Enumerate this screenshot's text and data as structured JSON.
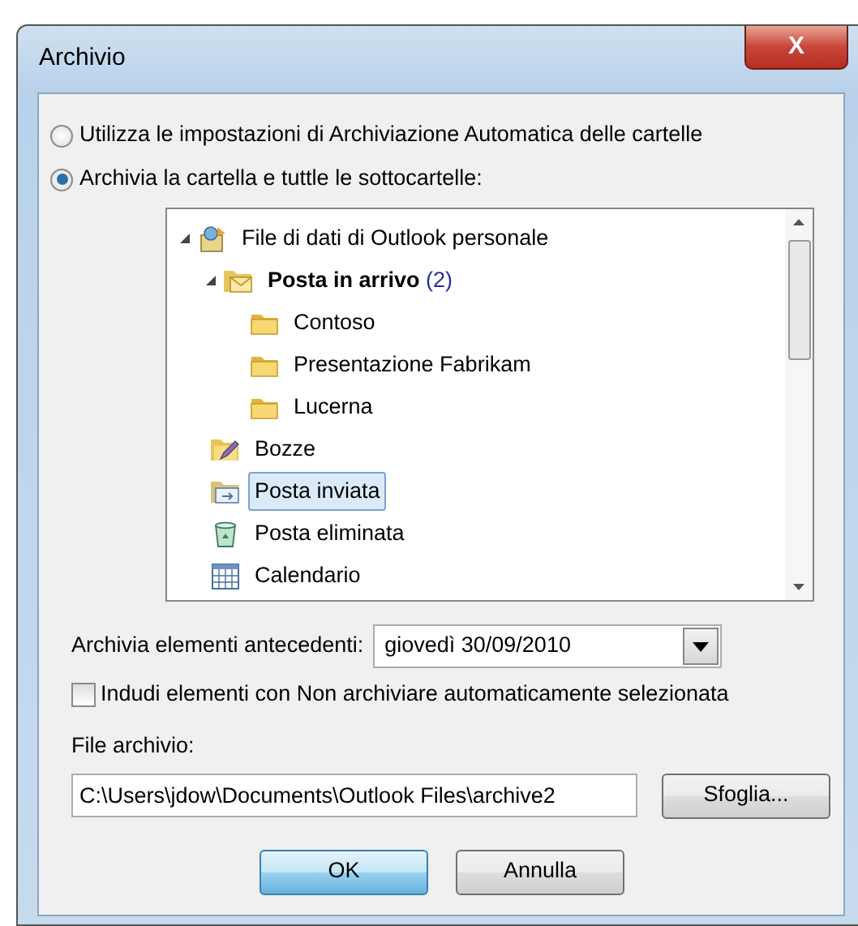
{
  "window": {
    "title": "Archivio",
    "close_label": "X"
  },
  "options": [
    {
      "label": "Utilizza le impostazioni di Archiviazione Automatica delle cartelle",
      "selected": false
    },
    {
      "label": "Archivia la cartella e tuttle le sottocartelle:",
      "selected": true
    }
  ],
  "folders": [
    {
      "label": "File di dati di Outlook personale",
      "kind": "datafile",
      "expanded": true,
      "selected": false,
      "children": [
        {
          "label": "Posta in arrivo",
          "count": "(2)",
          "bold": true,
          "kind": "inbox",
          "expanded": true,
          "selected": false,
          "children": [
            {
              "label": "Contoso",
              "kind": "folder",
              "selected": false
            },
            {
              "label": "Presentazione Fabrikam",
              "kind": "folder",
              "selected": false
            },
            {
              "label": "Lucerna",
              "kind": "folder",
              "selected": false
            }
          ]
        },
        {
          "label": "Bozze",
          "kind": "drafts",
          "selected": false
        },
        {
          "label": "Posta inviata",
          "kind": "sent",
          "selected": true
        },
        {
          "label": "Posta eliminata",
          "kind": "trash",
          "selected": false
        },
        {
          "label": "Calendario",
          "kind": "calendar",
          "selected": false
        }
      ]
    }
  ],
  "older_than": {
    "label": "Archivia elementi antecedenti:",
    "value": "giovedì 30/09/2010"
  },
  "include_noarchive": {
    "label": "Indudi elementi con Non archiviare automaticamente selezionata",
    "checked": false
  },
  "archive_file": {
    "label": "File archivio:",
    "value": "C:\\Users\\jdow\\Documents\\Outlook Files\\archive2",
    "browse": "Sfoglia..."
  },
  "buttons": [
    {
      "label": "OK",
      "default": true
    },
    {
      "label": "Annulla",
      "default": false
    }
  ]
}
